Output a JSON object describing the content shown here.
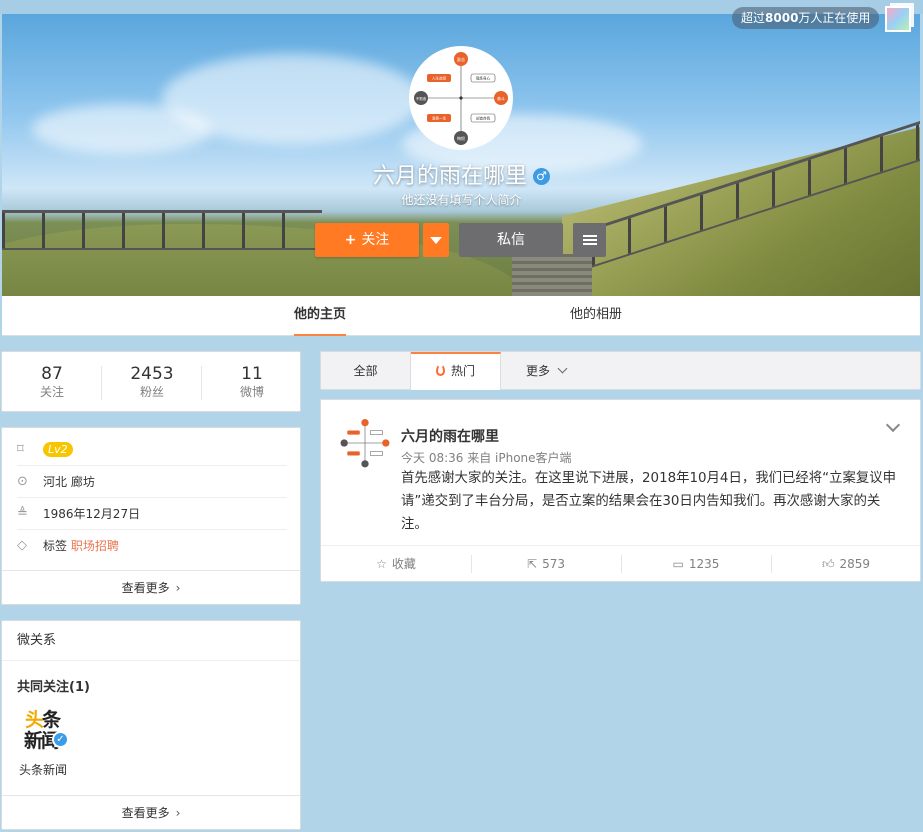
{
  "banner": {
    "usage_prefix": "超过",
    "usage_count": "8000",
    "usage_suffix": "万人正在使用"
  },
  "profile": {
    "name": "六月的雨在哪里",
    "gender_symbol": "♂",
    "bio": "他还没有填写个人简介",
    "follow_label": "关注",
    "message_label": "私信"
  },
  "tabs": {
    "home": "他的主页",
    "album": "他的相册"
  },
  "stats": [
    {
      "num": "87",
      "label": "关注"
    },
    {
      "num": "2453",
      "label": "粉丝"
    },
    {
      "num": "11",
      "label": "微博"
    }
  ],
  "info": {
    "level": "Lv2",
    "location": "河北 廊坊",
    "birthday": "1986年12月27日",
    "tag_label": "标签",
    "tag_value": "职场招聘",
    "see_more": "查看更多"
  },
  "relations": {
    "title": "微关系",
    "common_follow": "共同关注(1)",
    "account_logo_line1_a": "头",
    "account_logo_line1_b": "条",
    "account_logo_line2": "新闻",
    "account_name": "头条新闻",
    "see_more": "查看更多"
  },
  "filter": {
    "all": "全部",
    "hot": "热门",
    "more": "更多"
  },
  "post": {
    "author": "六月的雨在哪里",
    "meta": "今天 08:36 来自 iPhone客户端",
    "text": "首先感谢大家的关注。在这里说下进展，2018年10月4日，我们已经将“立案复议申请”递交到了丰台分局，是否立案的结果会在30日内告知我们。再次感谢大家的关注。",
    "favorite_label": "收藏",
    "reposts": "573",
    "comments": "1235",
    "likes": "2859"
  },
  "avatar_diagram": {
    "top": "励志",
    "bottom": "悔恨",
    "left": "不勤奋",
    "right": "奋斗",
    "tl": "人生选择",
    "tr": "锻炼身心",
    "bl": "浪费一生",
    "br": "创造自我"
  },
  "colors": {
    "accent": "#ff8140",
    "follow_button": "#ff7a22",
    "message_button": "#6d6d70",
    "link": "#eb7350",
    "page_bg": "#b2d4e8"
  }
}
